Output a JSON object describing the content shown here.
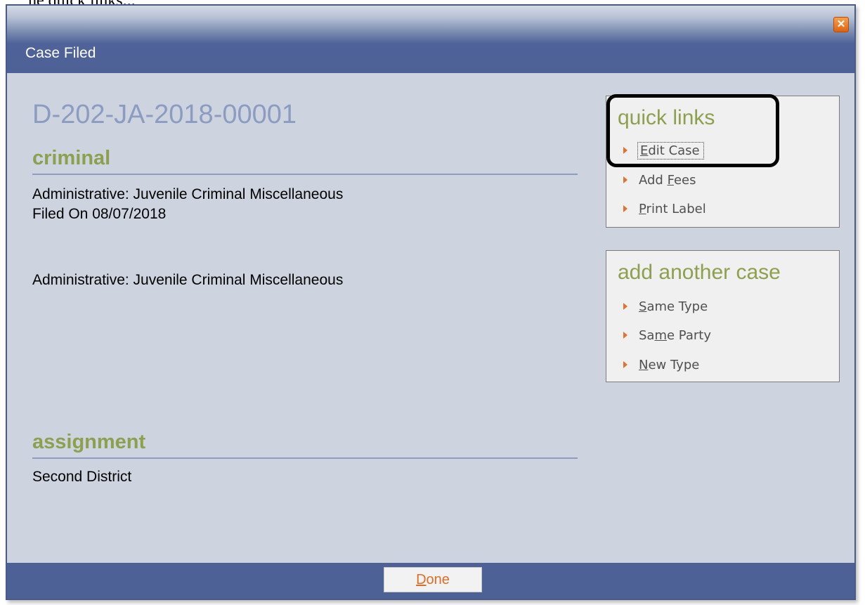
{
  "page_heading_fragment": "he quick links...",
  "dialog": {
    "title": "Case Filed",
    "close_glyph": "✕",
    "close_icon": "orange-close-x-icon"
  },
  "case": {
    "number": "D-202-JA-2018-00001",
    "criminal_heading": "criminal",
    "case_type": "Administrative: Juvenile Criminal Miscellaneous",
    "filed_on": "Filed On 08/07/2018",
    "case_type_repeat": "Administrative: Juvenile Criminal Miscellaneous",
    "assignment_heading": "assignment",
    "assignment_value": "Second District"
  },
  "quick_links": {
    "title": "quick links",
    "items": [
      {
        "pre": "",
        "key": "E",
        "post": "dit Case"
      },
      {
        "pre": "Add ",
        "key": "F",
        "post": "ees"
      },
      {
        "pre": "",
        "key": "P",
        "post": "rint Label"
      }
    ]
  },
  "add_another_case": {
    "title": "add another case",
    "items": [
      {
        "pre": "",
        "key": "S",
        "post": "ame Type"
      },
      {
        "pre": "Sa",
        "key": "m",
        "post": "e Party"
      },
      {
        "pre": "",
        "key": "N",
        "post": "ew Type"
      }
    ]
  },
  "footer": {
    "done": {
      "pre": "",
      "key": "D",
      "post": "one"
    }
  },
  "colors": {
    "accent_green": "#8da04d",
    "title_bar_blue": "#4d6197",
    "link_arrow_orange": "#e2732c",
    "case_number_blue": "#8b9cc0"
  }
}
